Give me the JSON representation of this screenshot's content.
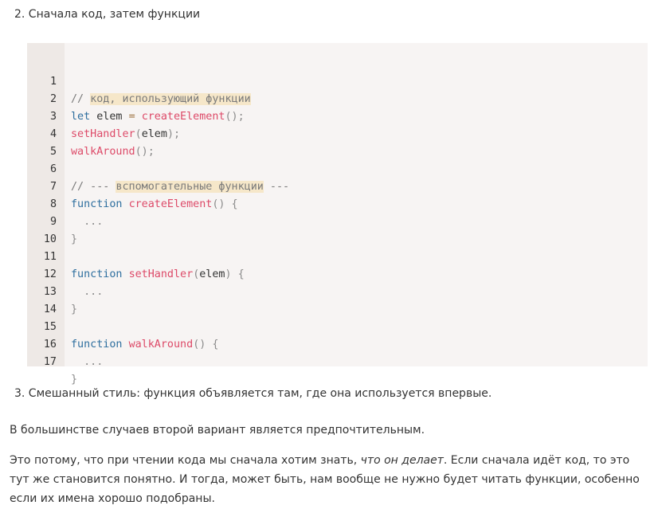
{
  "items": {
    "item2": "2. Сначала код, затем функции",
    "item3": "3. Смешанный стиль: функция объявляется там, где она используется впервые."
  },
  "code": {
    "line_numbers": [
      "1",
      "2",
      "3",
      "4",
      "5",
      "6",
      "7",
      "8",
      "9",
      "10",
      "11",
      "12",
      "13",
      "14",
      "15",
      "16",
      "17"
    ],
    "l1_comment_prefix": "// ",
    "l1_comment_hl": "код, использующий функции",
    "l2_kw": "let",
    "l2_var": " elem ",
    "l2_op": "=",
    "l2_fn": "createElement",
    "l2_punc": "();",
    "l3_fn": "setHandler",
    "l3_p1": "(",
    "l3_arg": "elem",
    "l3_p2": ");",
    "l4_fn": "walkAround",
    "l4_punc": "();",
    "l6_c1": "// --- ",
    "l6_hl": "вспомогательные функции",
    "l6_c2": " ---",
    "l7_kw": "function",
    "l7_fn": "createElement",
    "l7_punc": "() {",
    "l8_dots": "  ...",
    "l9_close": "}",
    "l11_kw": "function",
    "l11_fn": "setHandler",
    "l11_p1": "(",
    "l11_arg": "elem",
    "l11_p2": ") {",
    "l12_dots": "  ...",
    "l13_close": "}",
    "l15_kw": "function",
    "l15_fn": "walkAround",
    "l15_punc": "() {",
    "l16_dots": "  ...",
    "l17_close": "}"
  },
  "paragraphs": {
    "p1": "В большинстве случаев второй вариант является предпочтительным.",
    "p2_before": "Это потому, что при чтении кода мы сначала хотим знать, ",
    "p2_em": "что он делает",
    "p2_after": ". Если сначала идёт код, то это тут же становится понятно. И тогда, может быть, нам вообще не нужно будет читать функции, особенно если их имена хорошо подобраны."
  },
  "colors": {
    "code_background": "#f7f4f3",
    "gutter_background": "#eee9e6",
    "comment_highlight": "#f6e7c9",
    "keyword": "#2f6f9f",
    "function_name": "#dd4a68",
    "comment": "#7a7a7a"
  }
}
